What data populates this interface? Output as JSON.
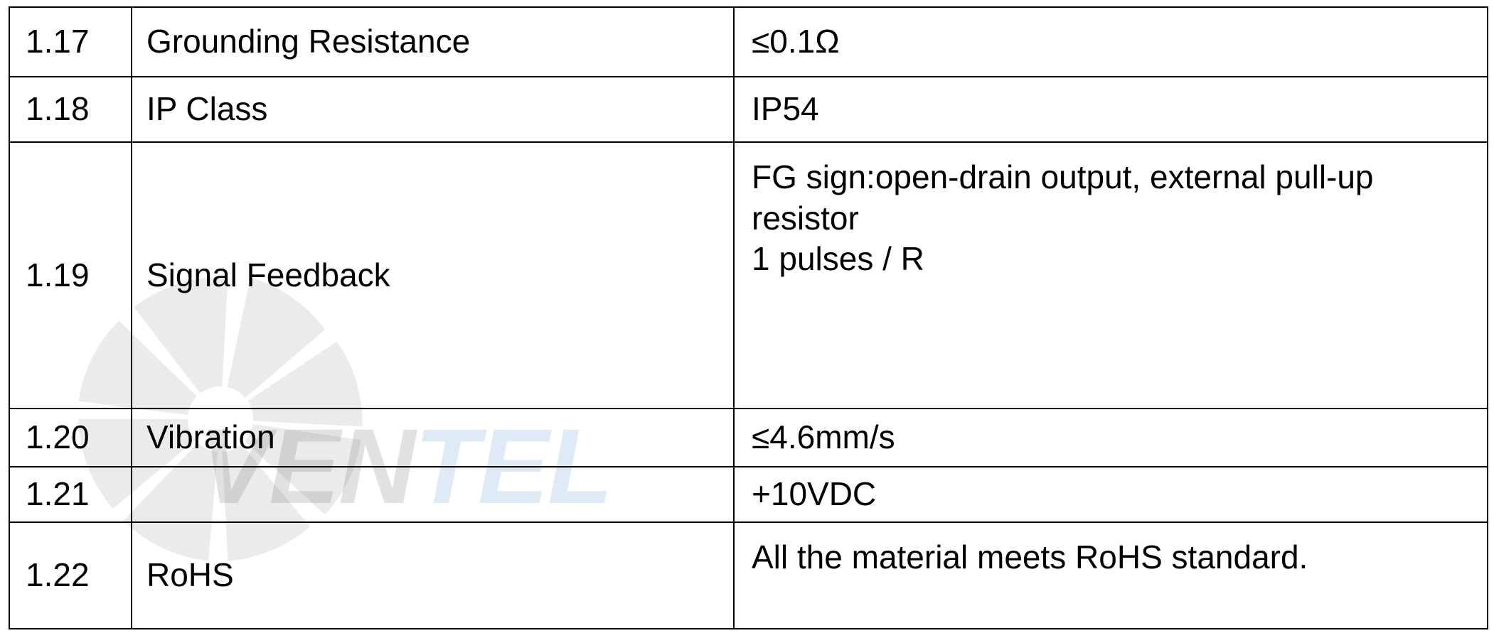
{
  "watermark": {
    "brand_left": "VEN",
    "brand_right": "TEL",
    "fan_icon": "fan-icon",
    "colors": {
      "gray": "#7a7a7a",
      "blue": "#6fa8d8"
    }
  },
  "rows": [
    {
      "num": "1.17",
      "name": "Grounding Resistance",
      "value_lines": [
        "≤0.1Ω"
      ]
    },
    {
      "num": "1.18",
      "name": "IP Class",
      "value_lines": [
        "IP54"
      ]
    },
    {
      "num": "1.19",
      "name": "Signal Feedback",
      "value_lines": [
        "FG sign:open-drain output, external pull-up",
        "resistor",
        "1 pulses / R"
      ]
    },
    {
      "num": "1.20",
      "name": "Vibration",
      "value_lines": [
        "≤4.6mm/s"
      ]
    },
    {
      "num": "1.21",
      "name": "",
      "value_lines": [
        "+10VDC"
      ]
    },
    {
      "num": "1.22",
      "name": "RoHS",
      "value_lines": [
        "All the material meets RoHS standard."
      ]
    }
  ]
}
